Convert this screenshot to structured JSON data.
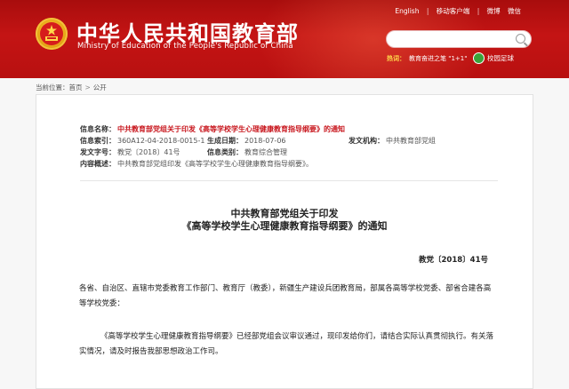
{
  "header": {
    "title": "中华人民共和国教育部",
    "subtitle": "Ministry of Education of the People's Republic of China",
    "links": [
      "English",
      "移动客户端",
      "微博",
      "微信"
    ],
    "hot_label": "热词：",
    "hot_link": "教育奋进之笔 \"1+1\"",
    "football_label": "校园足球"
  },
  "breadcrumb": {
    "prefix": "当前位置：",
    "items": [
      "首页",
      "公开"
    ]
  },
  "meta": {
    "info_name_label": "信息名称：",
    "info_name_value": "中共教育部党组关于印发《高等学校学生心理健康教育指导纲要》的通知",
    "info_index_label": "信息索引：",
    "info_index_value": "360A12-04-2018-0015-1",
    "created_label": "生成日期：",
    "created_value": "2018-07-06",
    "issuer_label": "发文机构：",
    "issuer_value": "中共教育部党组",
    "doc_no_label": "发文字号：",
    "doc_no_value": "教党〔2018〕41号",
    "category_label": "信息类别：",
    "category_value": "教育综合管理",
    "summary_label": "内容概述：",
    "summary_value": "中共教育部党组印发《高等学校学生心理健康教育指导纲要》。"
  },
  "document": {
    "title_line1": "中共教育部党组关于印发",
    "title_line2": "《高等学校学生心理健康教育指导纲要》的通知",
    "number": "教党〔2018〕41号",
    "para1": "各省、自治区、直辖市党委教育工作部门、教育厅（教委），新疆生产建设兵团教育局，部属各高等学校党委、部省合建各高等学校党委：",
    "para2": "《高等学校学生心理健康教育指导纲要》已经部党组会议审议通过，现印发给你们，请结合实际认真贯彻执行。有关落实情况，请及时报告我部思想政治工作司。"
  },
  "colors": {
    "header_red": "#c41414",
    "accent_red": "#c8161d",
    "hot_yellow": "#ffd84a"
  }
}
